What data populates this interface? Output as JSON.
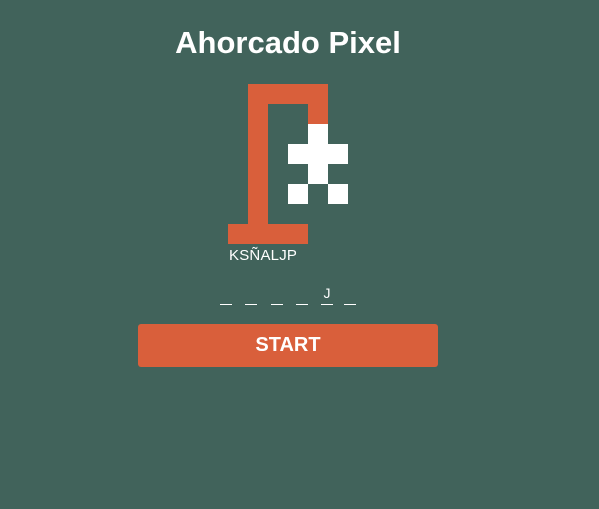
{
  "game": {
    "title": "Ahorcado Pixel",
    "used_letters": "KSÑALJP",
    "word_slots": [
      "",
      "",
      "",
      "",
      "J",
      ""
    ],
    "start_label": "START"
  },
  "colors": {
    "background": "#41635b",
    "gallows": "#d95f3b",
    "figure": "#ffffff",
    "button": "#d95f3b",
    "text": "#ffffff"
  }
}
